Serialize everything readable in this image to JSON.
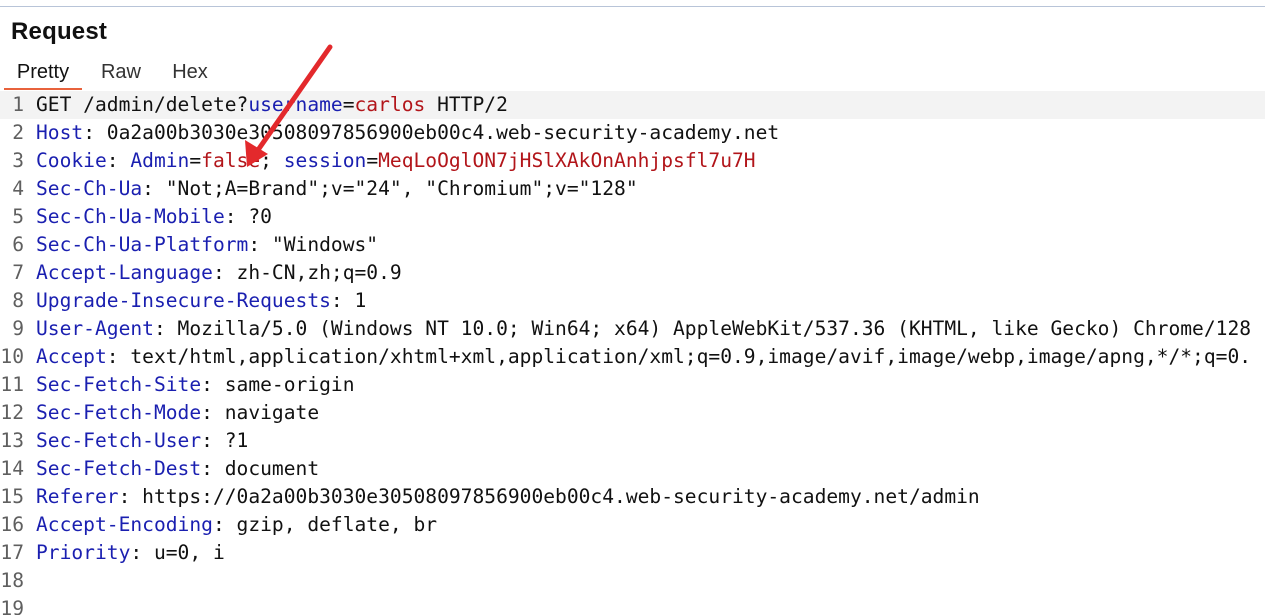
{
  "panel": {
    "title": "Request"
  },
  "tabs": [
    {
      "label": "Pretty",
      "active": true
    },
    {
      "label": "Raw",
      "active": false
    },
    {
      "label": "Hex",
      "active": false
    }
  ],
  "colors": {
    "header_name": "#1a1fb0",
    "param_value": "#b2151a",
    "active_tab_underline": "#e8623c",
    "annotation_arrow": "#e3292c"
  },
  "request_lines": [
    {
      "num": "1",
      "tokens": [
        {
          "t": "GET /admin/delete?",
          "c": "t-val"
        },
        {
          "t": "username",
          "c": "t-pname"
        },
        {
          "t": "=",
          "c": "t-punct"
        },
        {
          "t": "carlos",
          "c": "t-pval"
        },
        {
          "t": " HTTP/2",
          "c": "t-val"
        }
      ]
    },
    {
      "num": "2",
      "tokens": [
        {
          "t": "Host",
          "c": "t-key"
        },
        {
          "t": ": 0a2a00b3030e30508097856900eb00c4.web-security-academy.net",
          "c": "t-val"
        }
      ]
    },
    {
      "num": "3",
      "tokens": [
        {
          "t": "Cookie",
          "c": "t-key"
        },
        {
          "t": ": ",
          "c": "t-punct"
        },
        {
          "t": "Admin",
          "c": "t-pname"
        },
        {
          "t": "=",
          "c": "t-punct"
        },
        {
          "t": "false",
          "c": "t-pval"
        },
        {
          "t": "; ",
          "c": "t-punct"
        },
        {
          "t": "session",
          "c": "t-pname"
        },
        {
          "t": "=",
          "c": "t-punct"
        },
        {
          "t": "MeqLoOglON7jHSlXAkOnAnhjpsfl7u7H",
          "c": "t-pval"
        }
      ]
    },
    {
      "num": "4",
      "tokens": [
        {
          "t": "Sec-Ch-Ua",
          "c": "t-key"
        },
        {
          "t": ": \"Not;A=Brand\";v=\"24\", \"Chromium\";v=\"128\"",
          "c": "t-val"
        }
      ]
    },
    {
      "num": "5",
      "tokens": [
        {
          "t": "Sec-Ch-Ua-Mobile",
          "c": "t-key"
        },
        {
          "t": ": ?0",
          "c": "t-val"
        }
      ]
    },
    {
      "num": "6",
      "tokens": [
        {
          "t": "Sec-Ch-Ua-Platform",
          "c": "t-key"
        },
        {
          "t": ": \"Windows\"",
          "c": "t-val"
        }
      ]
    },
    {
      "num": "7",
      "tokens": [
        {
          "t": "Accept-Language",
          "c": "t-key"
        },
        {
          "t": ": zh-CN,zh;q=0.9",
          "c": "t-val"
        }
      ]
    },
    {
      "num": "8",
      "tokens": [
        {
          "t": "Upgrade-Insecure-Requests",
          "c": "t-key"
        },
        {
          "t": ": 1",
          "c": "t-val"
        }
      ]
    },
    {
      "num": "9",
      "tokens": [
        {
          "t": "User-Agent",
          "c": "t-key"
        },
        {
          "t": ": Mozilla/5.0 (Windows NT 10.0; Win64; x64) AppleWebKit/537.36 (KHTML, like Gecko) Chrome/128",
          "c": "t-val"
        }
      ]
    },
    {
      "num": "10",
      "tokens": [
        {
          "t": "Accept",
          "c": "t-key"
        },
        {
          "t": ": text/html,application/xhtml+xml,application/xml;q=0.9,image/avif,image/webp,image/apng,*/*;q=0.",
          "c": "t-val"
        }
      ]
    },
    {
      "num": "11",
      "tokens": [
        {
          "t": "Sec-Fetch-Site",
          "c": "t-key"
        },
        {
          "t": ": same-origin",
          "c": "t-val"
        }
      ]
    },
    {
      "num": "12",
      "tokens": [
        {
          "t": "Sec-Fetch-Mode",
          "c": "t-key"
        },
        {
          "t": ": navigate",
          "c": "t-val"
        }
      ]
    },
    {
      "num": "13",
      "tokens": [
        {
          "t": "Sec-Fetch-User",
          "c": "t-key"
        },
        {
          "t": ": ?1",
          "c": "t-val"
        }
      ]
    },
    {
      "num": "14",
      "tokens": [
        {
          "t": "Sec-Fetch-Dest",
          "c": "t-key"
        },
        {
          "t": ": document",
          "c": "t-val"
        }
      ]
    },
    {
      "num": "15",
      "tokens": [
        {
          "t": "Referer",
          "c": "t-key"
        },
        {
          "t": ": https://0a2a00b3030e30508097856900eb00c4.web-security-academy.net/admin",
          "c": "t-val"
        }
      ]
    },
    {
      "num": "16",
      "tokens": [
        {
          "t": "Accept-Encoding",
          "c": "t-key"
        },
        {
          "t": ": gzip, deflate, br",
          "c": "t-val"
        }
      ]
    },
    {
      "num": "17",
      "tokens": [
        {
          "t": "Priority",
          "c": "t-key"
        },
        {
          "t": ": u=0, i",
          "c": "t-val"
        }
      ]
    },
    {
      "num": "18",
      "tokens": []
    },
    {
      "num": "19",
      "tokens": []
    }
  ],
  "annotation": {
    "icon": "red-arrow-icon"
  }
}
